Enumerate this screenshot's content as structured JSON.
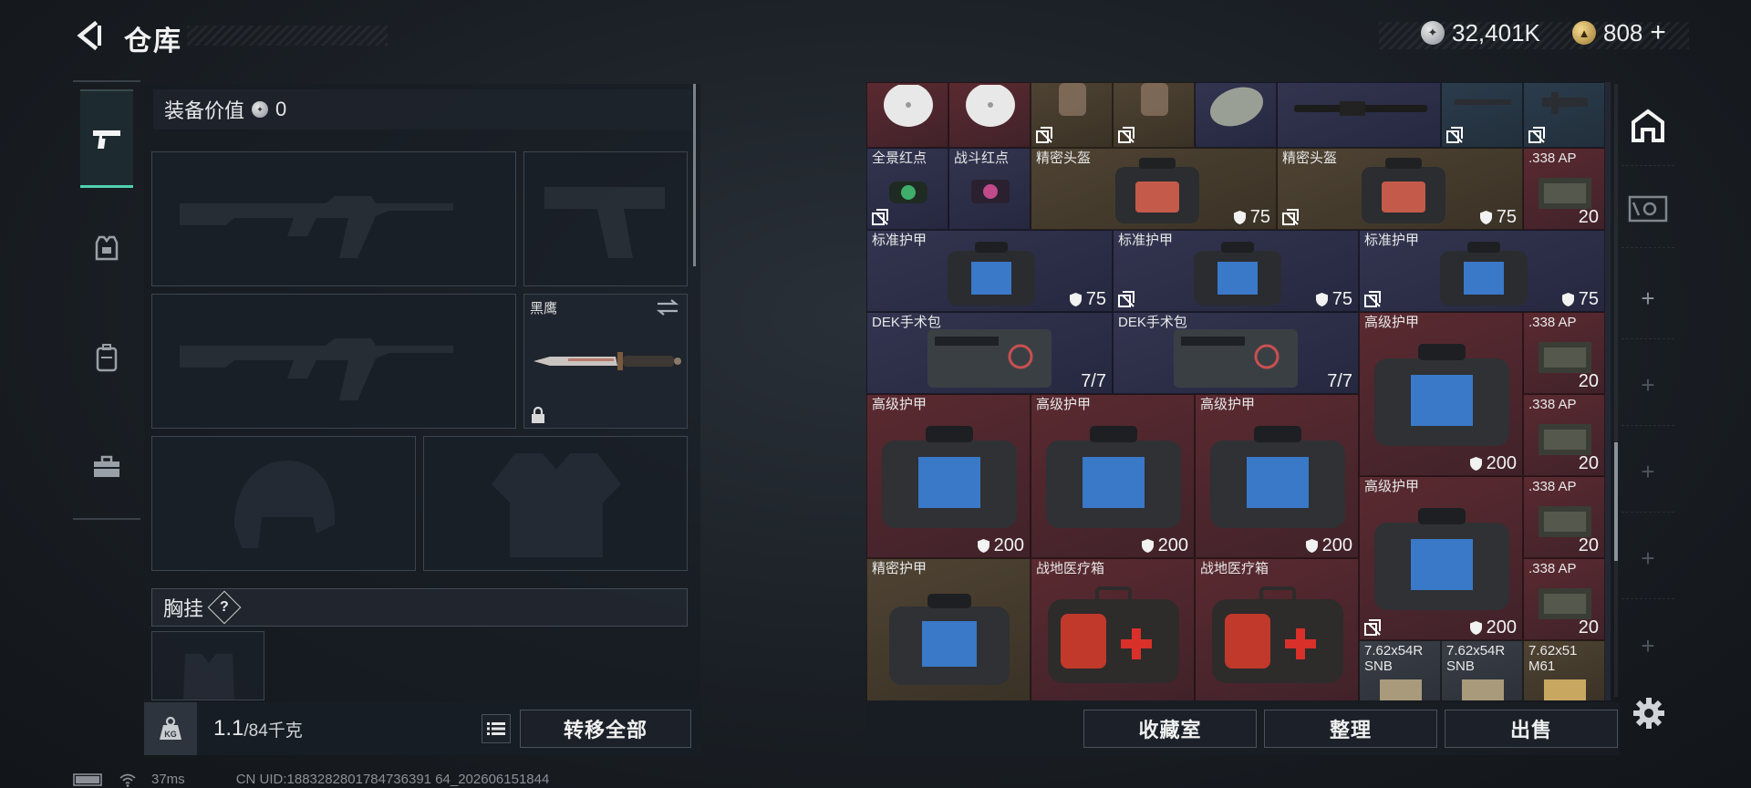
{
  "header": {
    "title": "仓库",
    "silver": "32,401K",
    "gold": "808",
    "gold_add": "+"
  },
  "sidebar": {
    "tabs": [
      "weapon-tab",
      "armor-tab",
      "backpack-tab",
      "toolbox-tab"
    ]
  },
  "loadout": {
    "equipment_value_label": "装备价值",
    "equipment_value": "0",
    "knife_name": "黑鹰",
    "chest_rig_label": "胸挂",
    "chest_help": "?",
    "weight_current": "1.1",
    "weight_max": "/84千克",
    "transfer_all": "转移全部",
    "kg_icon_label": "KG"
  },
  "grid": {
    "items": [
      {
        "name": "",
        "value": ""
      },
      {
        "name": "",
        "value": ""
      },
      {
        "name": "",
        "value": ""
      },
      {
        "name": "",
        "value": ""
      },
      {
        "name": "",
        "value": ""
      },
      {
        "name": "",
        "value": ""
      },
      {
        "name": "",
        "value": ""
      },
      {
        "name": "",
        "value": ""
      },
      {
        "name": "全景红点",
        "value": ""
      },
      {
        "name": "战斗红点",
        "value": ""
      },
      {
        "name": "精密头盔",
        "value": "75"
      },
      {
        "name": "精密头盔",
        "value": "75"
      },
      {
        "name": ".338 AP",
        "value": "20"
      },
      {
        "name": "标准护甲",
        "value": "75"
      },
      {
        "name": "标准护甲",
        "value": "75"
      },
      {
        "name": "标准护甲",
        "value": "75"
      },
      {
        "name": "DEK手术包",
        "value": "7/7"
      },
      {
        "name": "DEK手术包",
        "value": "7/7"
      },
      {
        "name": "高级护甲",
        "value": "200"
      },
      {
        "name": ".338 AP",
        "value": "20"
      },
      {
        "name": "高级护甲",
        "value": "200"
      },
      {
        "name": "高级护甲",
        "value": "200"
      },
      {
        "name": "高级护甲",
        "value": "200"
      },
      {
        "name": ".338 AP",
        "value": "20"
      },
      {
        "name": "高级护甲",
        "value": "200"
      },
      {
        "name": ".338 AP",
        "value": "20"
      },
      {
        "name": "精密护甲",
        "value": ""
      },
      {
        "name": "战地医疗箱",
        "value": ""
      },
      {
        "name": "战地医疗箱",
        "value": ""
      },
      {
        "name": ".338 AP",
        "value": "20"
      },
      {
        "name": "7.62x54R SNB",
        "value": ""
      },
      {
        "name": "7.62x54R SNB",
        "value": ""
      },
      {
        "name": "7.62x51 M61",
        "value": ""
      }
    ]
  },
  "actions": {
    "collection": "收藏室",
    "organize": "整理",
    "sell": "出售"
  },
  "status": {
    "ping": "37ms",
    "uid": "CN UID:1883282801784736391 64_202606151844"
  },
  "colors": {
    "accent": "#4fd1b0",
    "red_cell": "#5a2a30",
    "purple_cell": "#333550",
    "gold_cell": "#4f4333"
  }
}
